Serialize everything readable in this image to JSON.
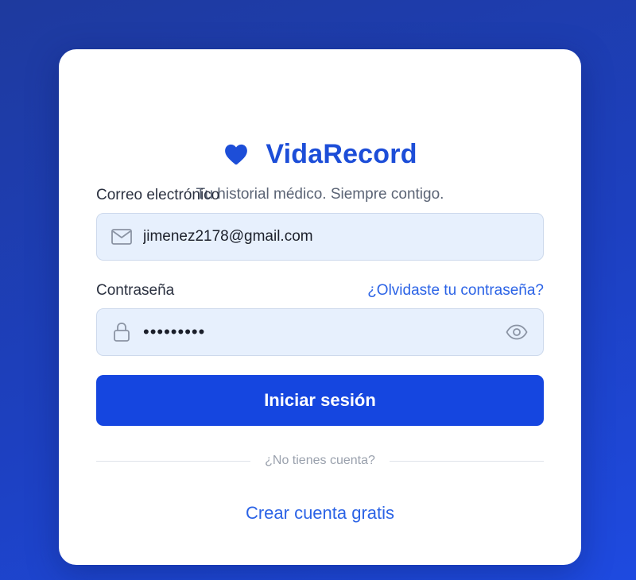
{
  "brand": {
    "name": "VidaRecord",
    "tagline": "Tu historial médico. Siempre contigo.",
    "color": "#1d4ed8"
  },
  "email": {
    "label": "Correo electrónico",
    "value": "jimenez2178@gmail.com",
    "icon": "mail-icon"
  },
  "password": {
    "label": "Contraseña",
    "value": "passwords",
    "forgot_link": "¿Olvidaste tu contraseña?",
    "icon": "lock-icon",
    "toggle_icon": "eye-icon"
  },
  "submit": {
    "label": "Iniciar sesión",
    "color": "#1546e0"
  },
  "signup": {
    "prompt": "¿No tienes cuenta?",
    "link": "Crear cuenta gratis"
  }
}
